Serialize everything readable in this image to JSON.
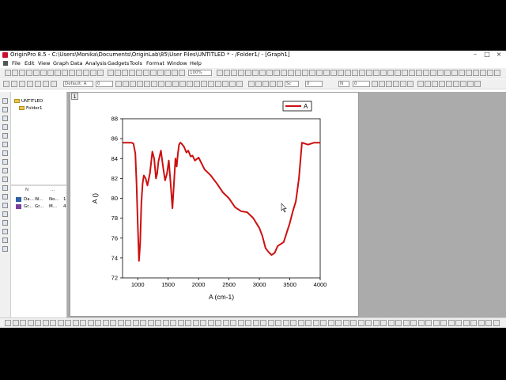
{
  "window": {
    "title": "OriginPro 8.5 - C:\\Users\\Monika\\Documents\\OriginLab\\85\\User Files\\UNTITLED * - /Folder1/ - [Graph1]"
  },
  "menu": [
    "File",
    "Edit",
    "View",
    "Graph",
    "Data",
    "Analysis",
    "Gadgets",
    "Tools",
    "Format",
    "Window",
    "Help"
  ],
  "toolbar": {
    "zoom_value": "100%",
    "font_value": "Default: A",
    "font_size_value": "0",
    "line_style_value": "Sc",
    "line_width_value": "0",
    "color_value": "N",
    "angle_value": "0"
  },
  "explorer": {
    "root": "UNTITLED",
    "folder": "Folder1",
    "columns": [
      "N",
      "..."
    ],
    "rows": [
      {
        "icon": "data-icon",
        "name": "Da...",
        "type": "W...",
        "view": "No...",
        "num": "1"
      },
      {
        "icon": "graph-icon",
        "name": "Gr...",
        "type": "Gr...",
        "view": "M...",
        "num": "4"
      }
    ]
  },
  "graph_window": {
    "layer_number": "1"
  },
  "colors": {
    "curve": "#cc1010",
    "mdi_background": "#ababab"
  },
  "chart_data": {
    "type": "line",
    "xlabel": "A (cm-1)",
    "ylabel": "A ()",
    "xlim": [
      750,
      4000
    ],
    "ylim": [
      72,
      88
    ],
    "xticks": [
      1000,
      1500,
      2000,
      2500,
      3000,
      3500,
      4000
    ],
    "yticks": [
      72,
      74,
      76,
      78,
      80,
      82,
      84,
      86,
      88
    ],
    "legend": "top-right",
    "series": [
      {
        "name": "A",
        "color": "#cc1010",
        "x": [
          750,
          800,
          850,
          900,
          930,
          960,
          980,
          1000,
          1020,
          1040,
          1060,
          1080,
          1100,
          1130,
          1160,
          1200,
          1240,
          1270,
          1300,
          1320,
          1340,
          1380,
          1420,
          1450,
          1480,
          1510,
          1540,
          1570,
          1600,
          1620,
          1640,
          1660,
          1680,
          1700,
          1720,
          1760,
          1800,
          1830,
          1870,
          1900,
          1940,
          1980,
          2000,
          2050,
          2100,
          2150,
          2200,
          2300,
          2400,
          2500,
          2600,
          2700,
          2800,
          2900,
          3000,
          3050,
          3100,
          3150,
          3200,
          3250,
          3300,
          3400,
          3500,
          3550,
          3600,
          3650,
          3700,
          3750,
          3800,
          3850,
          3900,
          3950,
          4000
        ],
        "y": [
          85.6,
          85.6,
          85.6,
          85.6,
          85.5,
          84.5,
          81.5,
          77.5,
          73.7,
          75.5,
          79.5,
          81.5,
          82.3,
          82.0,
          81.3,
          82.5,
          84.7,
          84.0,
          82.0,
          82.5,
          83.7,
          84.8,
          83.0,
          81.8,
          82.5,
          83.8,
          81.5,
          79.0,
          82.0,
          84.0,
          83.2,
          84.5,
          85.4,
          85.6,
          85.5,
          85.2,
          84.6,
          84.8,
          84.2,
          84.3,
          83.8,
          84.0,
          84.1,
          83.5,
          82.9,
          82.6,
          82.3,
          81.5,
          80.6,
          80.0,
          79.1,
          78.7,
          78.6,
          78.0,
          77.0,
          76.2,
          75.0,
          74.6,
          74.3,
          74.5,
          75.2,
          75.6,
          77.5,
          78.7,
          79.7,
          82.0,
          85.6,
          85.5,
          85.4,
          85.5,
          85.6,
          85.6,
          85.6
        ]
      }
    ]
  }
}
